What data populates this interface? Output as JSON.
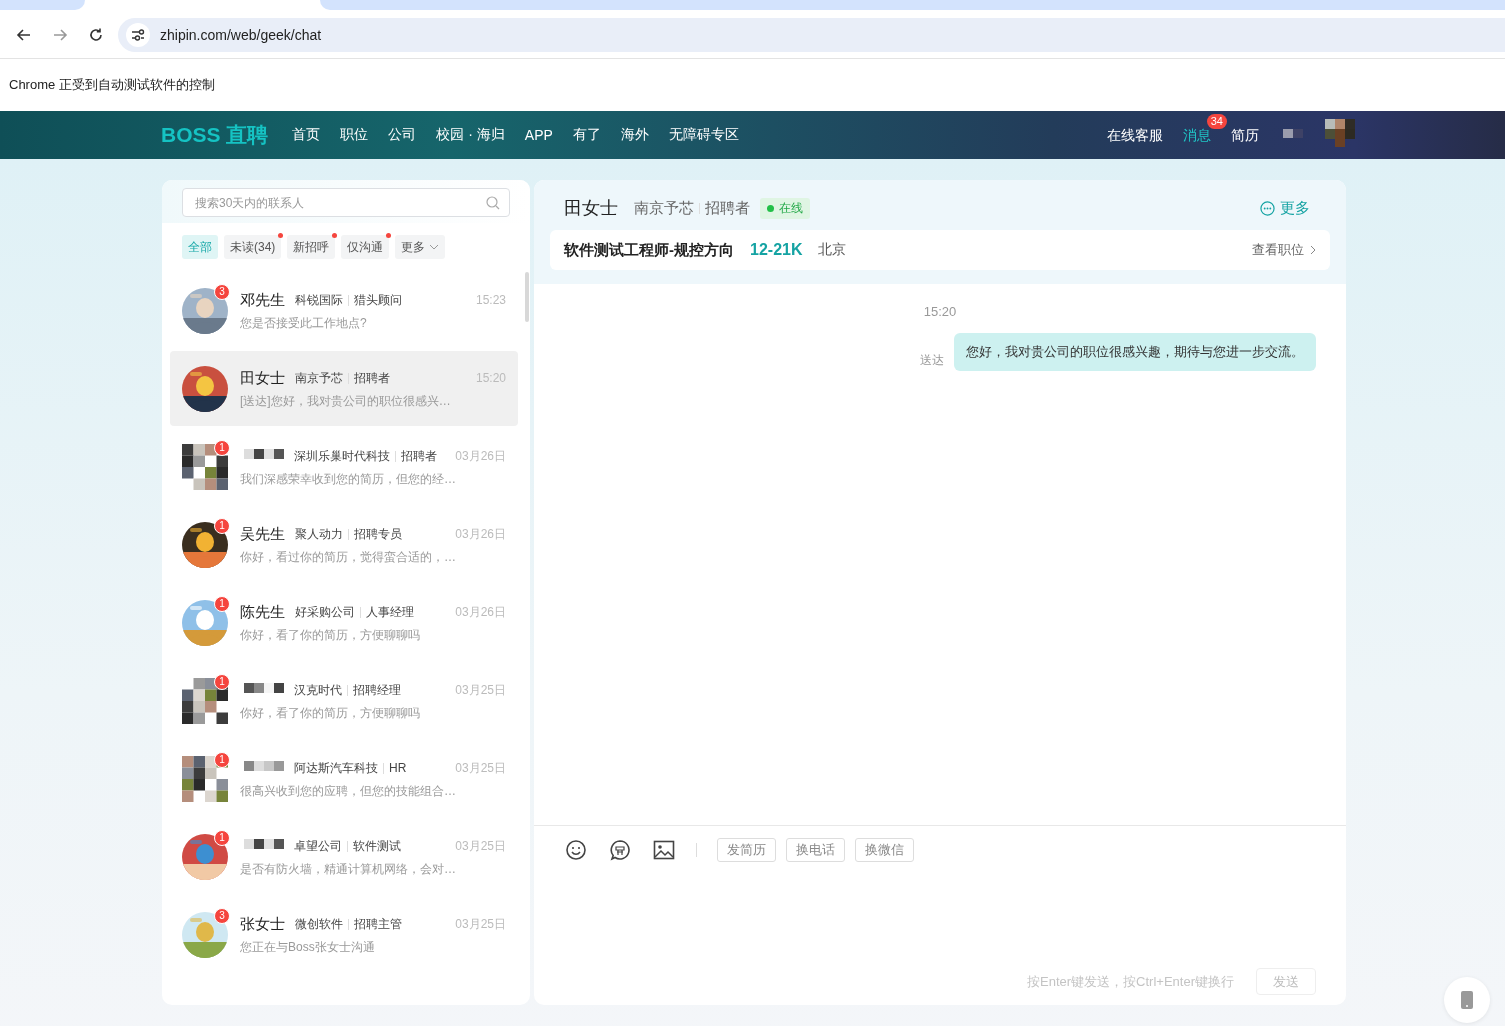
{
  "browser": {
    "url": "zhipin.com/web/geek/chat",
    "infobar": "Chrome 正受到自动测试软件的控制"
  },
  "nav": {
    "logo": "BOSS 直聘",
    "items": [
      {
        "label": "首页",
        "selected": false
      },
      {
        "label": "职位",
        "selected": false
      },
      {
        "label": "公司",
        "selected": false
      },
      {
        "label": "校园 · 海归",
        "selected": false
      },
      {
        "label": "APP",
        "selected": false
      },
      {
        "label": "有了",
        "selected": false
      },
      {
        "label": "海外",
        "selected": false
      },
      {
        "label": "无障碍专区",
        "selected": false
      }
    ],
    "right_items": [
      {
        "label": "在线客服",
        "selected": false
      },
      {
        "label": "消息",
        "selected": true,
        "badge": "34"
      },
      {
        "label": "简历",
        "selected": false
      }
    ]
  },
  "contacts_panel": {
    "search": {
      "placeholder": "搜索30天内的联系人"
    },
    "filters": [
      {
        "label": "全部",
        "selected": true,
        "dot": false
      },
      {
        "label": "未读(34)",
        "selected": false,
        "dot": true
      },
      {
        "label": "新招呼",
        "selected": false,
        "dot": true
      },
      {
        "label": "仅沟通",
        "selected": false,
        "dot": true
      },
      {
        "label": "更多",
        "selected": false,
        "dot": false
      }
    ],
    "contacts": [
      {
        "avatar_masked": false,
        "badge": "3",
        "name": "邓先生",
        "company": "科锐国际",
        "role": "猎头顾问",
        "time": "15:23",
        "preview": "您是否接受此工作地点?",
        "selected": false
      },
      {
        "avatar_masked": false,
        "name": "田女士",
        "company": "南京予芯",
        "role": "招聘者",
        "time": "15:20",
        "preview": "[送达]您好，我对贵公司的职位很感兴…",
        "selected": true
      },
      {
        "avatar_masked": true,
        "badge": "1",
        "name_masked": true,
        "company": "深圳乐巢时代科技",
        "role": "招聘者",
        "time": "03月26日",
        "preview": "我们深感荣幸收到您的简历，但您的经…",
        "selected": false
      },
      {
        "avatar_masked": false,
        "badge": "1",
        "name": "吴先生",
        "company": "聚人动力",
        "role": "招聘专员",
        "time": "03月26日",
        "preview": "你好，看过你的简历，觉得蛮合适的，…",
        "selected": false
      },
      {
        "avatar_masked": false,
        "badge": "1",
        "name": "陈先生",
        "company": "好采购公司",
        "role": "人事经理",
        "time": "03月26日",
        "preview": "你好，看了你的简历，方便聊聊吗",
        "selected": false
      },
      {
        "avatar_masked": true,
        "badge": "1",
        "name_masked": true,
        "company": "汉克时代",
        "role": "招聘经理",
        "time": "03月25日",
        "preview": "你好，看了你的简历，方便聊聊吗",
        "selected": false
      },
      {
        "avatar_masked": true,
        "badge": "1",
        "name_masked": true,
        "company": "阿达斯汽车科技",
        "role": "HR",
        "time": "03月25日",
        "preview": "很高兴收到您的应聘，但您的技能组合…",
        "selected": false
      },
      {
        "avatar_masked": false,
        "badge": "1",
        "name_masked": true,
        "company": "卓望公司",
        "role": "软件测试",
        "time": "03月25日",
        "preview": "是否有防火墙，精通计算机网络，会对…",
        "selected": false
      },
      {
        "avatar_masked": false,
        "badge": "3",
        "name": "张女士",
        "company": "微创软件",
        "role": "招聘主管",
        "time": "03月25日",
        "preview": "您正在与Boss张女士沟通",
        "selected": false
      }
    ]
  },
  "chat": {
    "name": "田女士",
    "company": "南京予芯",
    "role": "招聘者",
    "status": "在线",
    "more": "更多",
    "job": {
      "title": "软件测试工程师-规控方向",
      "salary": "12-21K",
      "city": "北京",
      "link": "查看职位"
    },
    "messages": [
      {
        "kind": "time",
        "text": "15:20"
      },
      {
        "kind": "sent",
        "status": "送达",
        "text": "您好，我对贵公司的职位很感兴趣，期待与您进一步交流。"
      }
    ],
    "actions": [
      "发简历",
      "换电话",
      "换微信"
    ],
    "hint": "按Enter键发送，按Ctrl+Enter键换行",
    "send": {
      "label": "发送",
      "disabled": true
    }
  }
}
